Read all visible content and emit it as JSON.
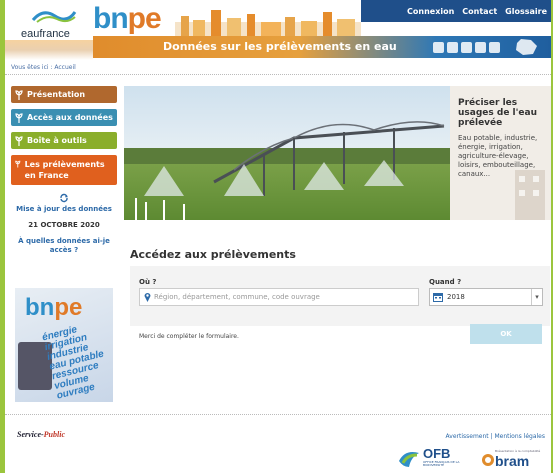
{
  "header": {
    "logo_text": "eaufrance",
    "brand_left": "bn",
    "brand_right": "pe",
    "top_links": [
      "Connexion",
      "Contact",
      "Glossaire"
    ],
    "title": "Données sur les prélèvements en eau"
  },
  "breadcrumb": "Vous êtes ici : Accueil",
  "sidebar": {
    "items": [
      {
        "label": "Présentation",
        "color": "#b0682e"
      },
      {
        "label": "Accès aux données",
        "color": "#3a8fb2"
      },
      {
        "label": "Boîte à outils",
        "color": "#8aae2b"
      },
      {
        "label": "Les prélèvements en France",
        "color": "#e0601e"
      }
    ],
    "update_label": "Mise à jour des données",
    "update_date": "21 OCTOBRE 2020",
    "which_data": "À quelles données ai-je accès ?",
    "promo": {
      "brand_left": "bn",
      "brand_right": "pe",
      "words": [
        "énergie",
        "irrigation",
        "industrie",
        "eau potable",
        "ressource",
        "volume",
        "ouvrage"
      ]
    }
  },
  "hero": {
    "heading": "Préciser les usages de l'eau prélevée",
    "text": "Eau potable, industrie, énergie, irrigation, agriculture-élevage, loisirs, embouteillage, canaux..."
  },
  "access": {
    "title": "Accédez aux prélèvements",
    "where_label": "Où ?",
    "where_placeholder": "Région, département, commune, code ouvrage",
    "when_label": "Quand ?",
    "year": "2018",
    "message": "Merci de compléter le formulaire.",
    "ok_label": "OK"
  },
  "footer": {
    "service_public_a": "Service-",
    "service_public_b": "Public",
    "links": "Avertissement | Mentions légales",
    "ofb_title": "OFB",
    "ofb_sub": "OFFICE FRANÇAIS DE LA BIODIVERSITÉ",
    "bram_title": "bram",
    "bram_sub": "Brésentation à la comptabilité"
  }
}
